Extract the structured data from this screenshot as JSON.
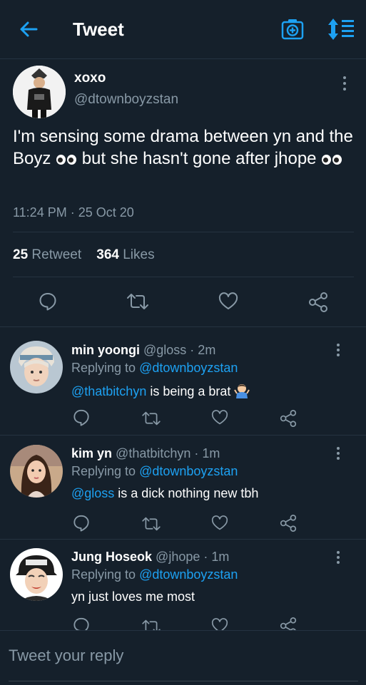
{
  "header": {
    "title": "Tweet",
    "back_icon": "arrow-left-icon",
    "camera_icon": "camera-plus-icon",
    "sort_icon": "sort-arrows-icon"
  },
  "tweet": {
    "name": "xoxo",
    "handle": "@dtownboyzstan",
    "text_part1": "I'm sensing some drama between yn and the Boyz ",
    "text_part2": " but she hasn't gone after jhope ",
    "timestamp": "11:24 PM · 25 Oct 20",
    "retweet_count": "25",
    "retweet_label": "Retweet",
    "likes_count": "364",
    "likes_label": "Likes"
  },
  "replies": [
    {
      "name": "min yoongi",
      "handle": "@gloss · 2m",
      "replying_label": "Replying to",
      "replying_to": "@dtownboyzstan",
      "mention": "@thatbitchyn",
      "text": " is being a brat "
    },
    {
      "name": "kim yn",
      "handle": "@thatbitchyn · 1m",
      "replying_label": "Replying to",
      "replying_to": "@dtownboyzstan",
      "mention": "@gloss",
      "text": " is a dick nothing new tbh"
    },
    {
      "name": "Jung Hoseok",
      "handle": "@jhope · 1m",
      "replying_label": "Replying to",
      "replying_to": "@dtownboyzstan",
      "mention": "",
      "text": "yn just loves me most"
    }
  ],
  "reply_bar": {
    "placeholder": "Tweet your reply"
  },
  "colors": {
    "background": "#15202b",
    "accent": "#1da1f2",
    "muted": "#8899a6",
    "divider": "#253341"
  }
}
